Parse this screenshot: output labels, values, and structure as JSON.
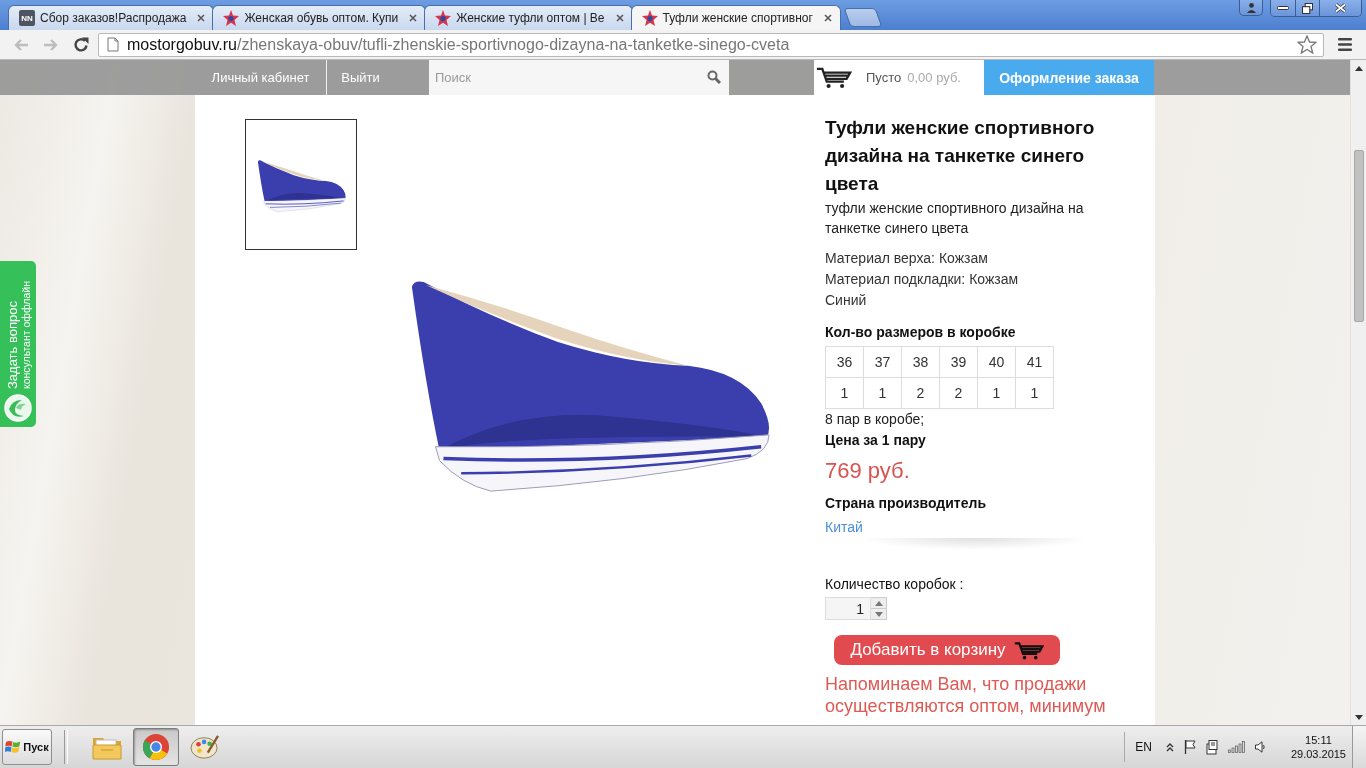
{
  "browser": {
    "tabs": [
      {
        "kind": "badge",
        "badge": "NN",
        "title": "Сбор заказов!Распродажа",
        "selected": false
      },
      {
        "kind": "logo",
        "title": "Женская обувь оптом. Купи",
        "selected": false
      },
      {
        "kind": "logo",
        "title": "Женские туфли оптом | Ве",
        "selected": false
      },
      {
        "kind": "logo",
        "title": "Туфли женские спортивног",
        "selected": true
      }
    ],
    "nav": {
      "back": {
        "disabled": true
      },
      "forward": {
        "disabled": true
      }
    },
    "url": {
      "domain": "mostorgobuv.ru",
      "path": "/zhenskaya-obuv/tufli-zhenskie-sportivnogo-dizayna-na-tanketke-sinego-cveta"
    }
  },
  "header": {
    "account_links": [
      "Личный кабинет",
      "Выйти"
    ],
    "search": {
      "placeholder": "Поиск"
    },
    "cart": {
      "status": "Пусто",
      "total": "0,00 руб."
    },
    "checkout_button": "Оформление заказа"
  },
  "side_widget": {
    "title": "Задать вопрос",
    "subtitle": "консультант оффлайн"
  },
  "product": {
    "title": "Туфли женские спортивного дизайна на танкетке синего цвета",
    "subtitle": "туфли женские спортивного дизайна на танкетке синего цвета",
    "specs": [
      "Материал верха: Кожзам",
      "Материал подкладки: Кожзам",
      "Синий"
    ],
    "sizes": {
      "heading": "Кол-во размеров в коробке",
      "rows": [
        [
          "36",
          "37",
          "38",
          "39",
          "40",
          "41"
        ],
        [
          "1",
          "1",
          "2",
          "2",
          "1",
          "1"
        ]
      ]
    },
    "pairs_note": "8 пар в коробе;",
    "price_label": "Цена за 1 пару",
    "price": "769 руб.",
    "country_label": "Страна производитель",
    "country": "Китай",
    "quantity_label": "Количество коробок :",
    "quantity": "1",
    "add_button": "Добавить в корзину",
    "notice": "Напоминаем Вам, что продажи осуществляются оптом, минимум"
  },
  "taskbar": {
    "start": "Пуск",
    "apps": [
      {
        "kind": "folder",
        "selected": false
      },
      {
        "kind": "browser",
        "selected": true
      },
      {
        "kind": "paint",
        "selected": false
      }
    ],
    "language": "EN",
    "time": "15:11",
    "date": "29.03.2015"
  }
}
